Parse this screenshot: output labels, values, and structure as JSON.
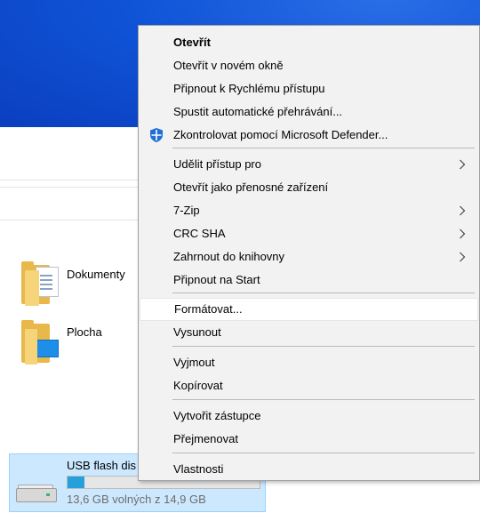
{
  "explorer": {
    "folders": [
      {
        "label": "Dokumenty",
        "icon": "documents-folder-icon"
      },
      {
        "label": "Plocha",
        "icon": "desktop-folder-icon"
      }
    ],
    "drive": {
      "title": "USB flash dis",
      "free_text": "13,6 GB volných z 14,9 GB",
      "used_fraction": 0.09,
      "icon": "usb-drive-icon"
    }
  },
  "context_menu": {
    "items": [
      {
        "label": "Otevřít",
        "bold": true
      },
      {
        "label": "Otevřít v novém okně"
      },
      {
        "label": "Připnout k Rychlému přístupu"
      },
      {
        "label": "Spustit automatické přehrávání..."
      },
      {
        "label": "Zkontrolovat pomocí Microsoft Defender...",
        "icon": "defender-shield-icon"
      },
      {
        "label": "Udělit přístup pro",
        "submenu": true
      },
      {
        "label": "Otevřít jako přenosné zařízení"
      },
      {
        "label": "7-Zip",
        "submenu": true
      },
      {
        "label": "CRC SHA",
        "submenu": true
      },
      {
        "label": "Zahrnout do knihovny",
        "submenu": true
      },
      {
        "label": "Připnout na Start"
      },
      {
        "label": "Formátovat...",
        "highlighted": true
      },
      {
        "label": "Vysunout"
      },
      {
        "label": "Vyjmout"
      },
      {
        "label": "Kopírovat"
      },
      {
        "label": "Vytvořit zástupce"
      },
      {
        "label": "Přejmenovat"
      },
      {
        "label": "Vlastnosti"
      }
    ]
  },
  "colors": {
    "accent": "#1054d8",
    "selection": "#cce8ff",
    "progress": "#26a0da",
    "menu_bg": "#f2f2f2"
  }
}
